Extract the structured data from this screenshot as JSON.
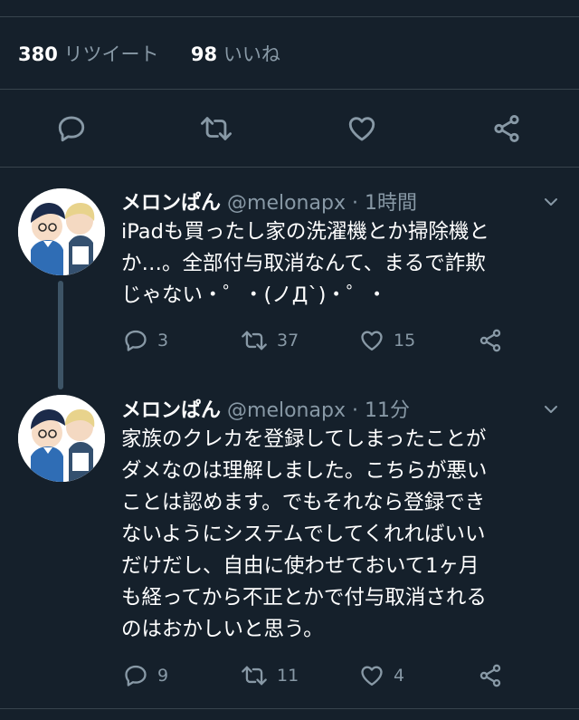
{
  "stats": {
    "retweets_count": "380",
    "retweets_label": "リツイート",
    "likes_count": "98",
    "likes_label": "いいね"
  },
  "main_actions": {
    "reply_icon": "reply-icon",
    "retweet_icon": "retweet-icon",
    "like_icon": "heart-icon",
    "share_icon": "share-icon"
  },
  "tweets": [
    {
      "name": "メロンぱん",
      "handle": "@melonapx",
      "time": "· 1時間",
      "lines": [
        "iPadも買ったし家の洗濯機とか掃除機と",
        "か…。全部付与取消なんて、まるで詐欺",
        "じゃない・゜・(ノД`)・゜・"
      ],
      "replies": "3",
      "retweets": "37",
      "likes": "15"
    },
    {
      "name": "メロンぱん",
      "handle": "@melonapx",
      "time": "· 11分",
      "lines": [
        "家族のクレカを登録してしまったことが",
        "ダメなのは理解しました。こちらが悪い",
        "ことは認めます。でもそれなら登録でき",
        "ないようにシステムでしてくれればいい",
        "だけだし、自由に使わせておいて1ヶ月",
        "も経ってから不正とかで付与取消される",
        "のはおかしいと思う。"
      ],
      "replies": "9",
      "retweets": "11",
      "likes": "4"
    }
  ],
  "colors": {
    "background": "#15202b",
    "secondary_text": "#8899a6",
    "divider": "#38444d",
    "primary_text": "#ffffff"
  }
}
